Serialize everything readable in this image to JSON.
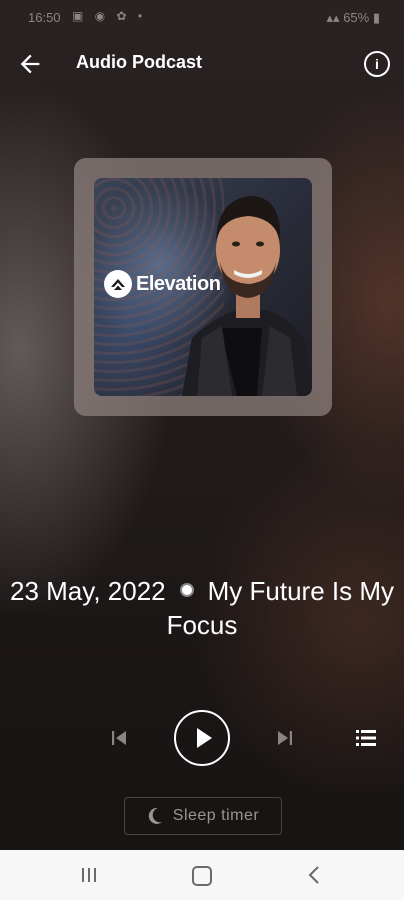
{
  "status_bar": {
    "time": "16:50",
    "left_icons": "▣ ◉ ✿ •",
    "battery": "65%"
  },
  "app_bar": {
    "title": "Audio Podcast",
    "back_icon": "arrow-left-icon",
    "info_icon": "info-icon",
    "info_glyph": "i"
  },
  "artwork": {
    "logo_text": "Elevation"
  },
  "episode": {
    "date": "23 May, 2022",
    "title": "My Future Is My Focus"
  },
  "controls": {
    "prev_icon": "skip-previous-icon",
    "play_icon": "play-icon",
    "next_icon": "skip-next-icon",
    "queue_icon": "playlist-icon"
  },
  "sleep_timer": {
    "label": "Sleep timer"
  },
  "nav_bar": {
    "recent_icon": "recent-apps-icon",
    "home_icon": "home-icon",
    "back_icon": "back-chevron-icon"
  },
  "colors": {
    "accent": "#ffffff",
    "muted_control": "#8a8484",
    "background": "#1c1717"
  }
}
